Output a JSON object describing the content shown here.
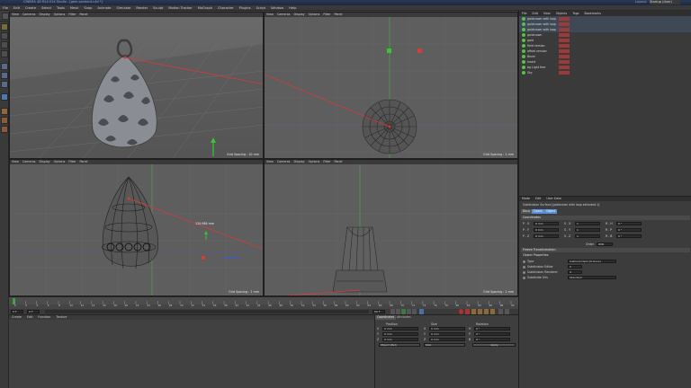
{
  "app": {
    "title": "CINEMA 4D R14.014 Studio - [gem pendant.c4d *]",
    "layout_label": "Layout:",
    "layout_value": "Startup (User)"
  },
  "menu": [
    "File",
    "Edit",
    "Create",
    "Select",
    "Tools",
    "Mesh",
    "Snap",
    "Animate",
    "Simulate",
    "Render",
    "Sculpt",
    "Motion Tracker",
    "MoGraph",
    "Character",
    "Plugins",
    "Script",
    "Window",
    "Help"
  ],
  "toolbar_fields": {
    "scale_step_label": "Scale Step",
    "scale_step": "10 %",
    "rotate_step_label": "Rotate Step",
    "rotate_step": "10°",
    "move_step_label": "Move Step",
    "move_step": "1 mm"
  },
  "viewports": [
    {
      "name": "Perspective",
      "menu": [
        "View",
        "Cameras",
        "Display",
        "Options",
        "Filter",
        "Panel"
      ],
      "grid": "Grid Spacing : 10 mm"
    },
    {
      "name": "Top",
      "menu": [
        "View",
        "Cameras",
        "Display",
        "Options",
        "Filter",
        "Panel"
      ],
      "grid": "Grid Spacing : 1 mm"
    },
    {
      "name": "Right",
      "menu": [
        "View",
        "Cameras",
        "Display",
        "Options",
        "Filter",
        "Panel"
      ],
      "grid": "Grid Spacing : 1 mm",
      "measure": "120.984 mm"
    },
    {
      "name": "Front",
      "menu": [
        "View",
        "Cameras",
        "Display",
        "Options",
        "Filter",
        "Panel"
      ],
      "grid": "Grid Spacing : 1 mm"
    }
  ],
  "timeline": {
    "ticks": [
      "0",
      "2",
      "4",
      "6",
      "8",
      "10",
      "12",
      "14",
      "16",
      "18",
      "20",
      "22",
      "24",
      "26",
      "28",
      "30",
      "32",
      "34",
      "36",
      "38",
      "40",
      "42",
      "44",
      "46",
      "48",
      "50",
      "52",
      "54",
      "56",
      "58",
      "60",
      "62",
      "64",
      "66",
      "68",
      "70",
      "72",
      "74",
      "76",
      "78",
      "80",
      "82",
      "84",
      "86",
      "88",
      "90"
    ],
    "frame_start": "0 F",
    "frame_end": "90 F",
    "current": "0 F"
  },
  "material_menu": [
    "Create",
    "Edit",
    "Function",
    "Texture"
  ],
  "coordinates": {
    "tabs": [
      "Coordinates",
      "Attributes"
    ],
    "col_position": "Position",
    "col_size": "Size",
    "col_rotation": "Rotation",
    "rows": [
      {
        "axis": "X",
        "pos": "0 mm",
        "size_axis": "X",
        "size": "0 mm",
        "rot_axis": "H",
        "rot": "0 °"
      },
      {
        "axis": "Y",
        "pos": "0 mm",
        "size_axis": "Y",
        "size": "0 mm",
        "rot_axis": "P",
        "rot": "0 °"
      },
      {
        "axis": "Z",
        "pos": "0 mm",
        "size_axis": "Z",
        "size": "0 mm",
        "rot_axis": "B",
        "rot": "0 °"
      }
    ],
    "mode": "Object (Rel)",
    "size_mode": "Size",
    "apply": "Apply"
  },
  "object_manager": {
    "menu": [
      "File",
      "Edit",
      "View",
      "Objects",
      "Tags",
      "Bookmarks"
    ],
    "objects": [
      {
        "name": "goldcrown with loop"
      },
      {
        "name": "goldcrown with loop"
      },
      {
        "name": "goldcrown with loop"
      },
      {
        "name": "goldcrown"
      },
      {
        "name": "gold"
      },
      {
        "name": "field version"
      },
      {
        "name": "offset version"
      },
      {
        "name": "Bezel"
      },
      {
        "name": "Insert"
      },
      {
        "name": "bg Light free"
      },
      {
        "name": "Sky"
      }
    ]
  },
  "attributes": {
    "menu": [
      "Mode",
      "Edit",
      "User Data"
    ],
    "title": "Subdivision Surface [goldcrown with loop extruded.1]",
    "tabs": [
      "Basic",
      "Coord.",
      "Object"
    ],
    "coord_header": "Coordinates",
    "coord_rows": [
      {
        "a": "P . X",
        "av": "0 mm",
        "b": "S . X",
        "bv": "1",
        "c": "R . H",
        "cv": "0 °"
      },
      {
        "a": "P . Y",
        "av": "0 mm",
        "b": "S . Y",
        "bv": "1",
        "c": "R . P",
        "cv": "0 °"
      },
      {
        "a": "P . Z",
        "av": "0 mm",
        "b": "S . Z",
        "bv": "1",
        "c": "R . B",
        "cv": "0 °"
      }
    ],
    "order_label": "Order",
    "order_value": "HPB",
    "freeze_header": "Freeze Transformation",
    "props_header": "Object Properties",
    "props": [
      {
        "label": "Type",
        "value": "Catmull-Clark (N-Gons)"
      },
      {
        "label": "Subdivision Editor",
        "value": "2"
      },
      {
        "label": "Subdivision Renderer",
        "value": "4"
      },
      {
        "label": "Subdivide UVs",
        "value": "Standard"
      }
    ]
  },
  "colors": {
    "accent": "#5a8fd8",
    "viewport": "#5e5e5e",
    "ui": "#3b3b3b",
    "red_axis": "#d43b3b",
    "green_axis": "#37c437",
    "blue_axis": "#3b5bd4"
  }
}
